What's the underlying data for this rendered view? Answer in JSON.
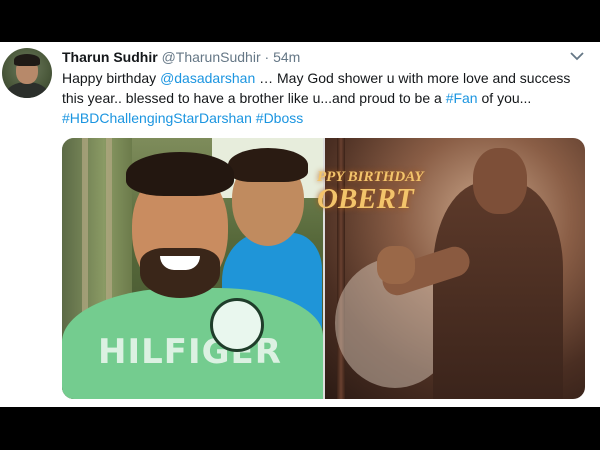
{
  "tweet": {
    "author_name": "Tharun Sudhir",
    "author_handle": "@TharunSudhir",
    "separator": "·",
    "time": "54m",
    "text": {
      "part1": "Happy birthday ",
      "mention": "@dasadarshan",
      "part2": " … May God shower u with more love and success this year.. blessed to have a brother like u...and proud to be a ",
      "hashtag_fan": "#Fan",
      "part3": " of you...",
      "hashtag1": "#HBDChallengingStarDarshan",
      "space": " ",
      "hashtag2": "#Dboss"
    },
    "poster": {
      "line1": "PPY BIRTHDAY",
      "line2": "OBERT"
    },
    "shirt_text": "HILFIGER"
  },
  "colors": {
    "link": "#1b95e0",
    "name": "#14171a",
    "muted": "#657786"
  },
  "icons": {
    "menu": "chevron-down-icon"
  }
}
